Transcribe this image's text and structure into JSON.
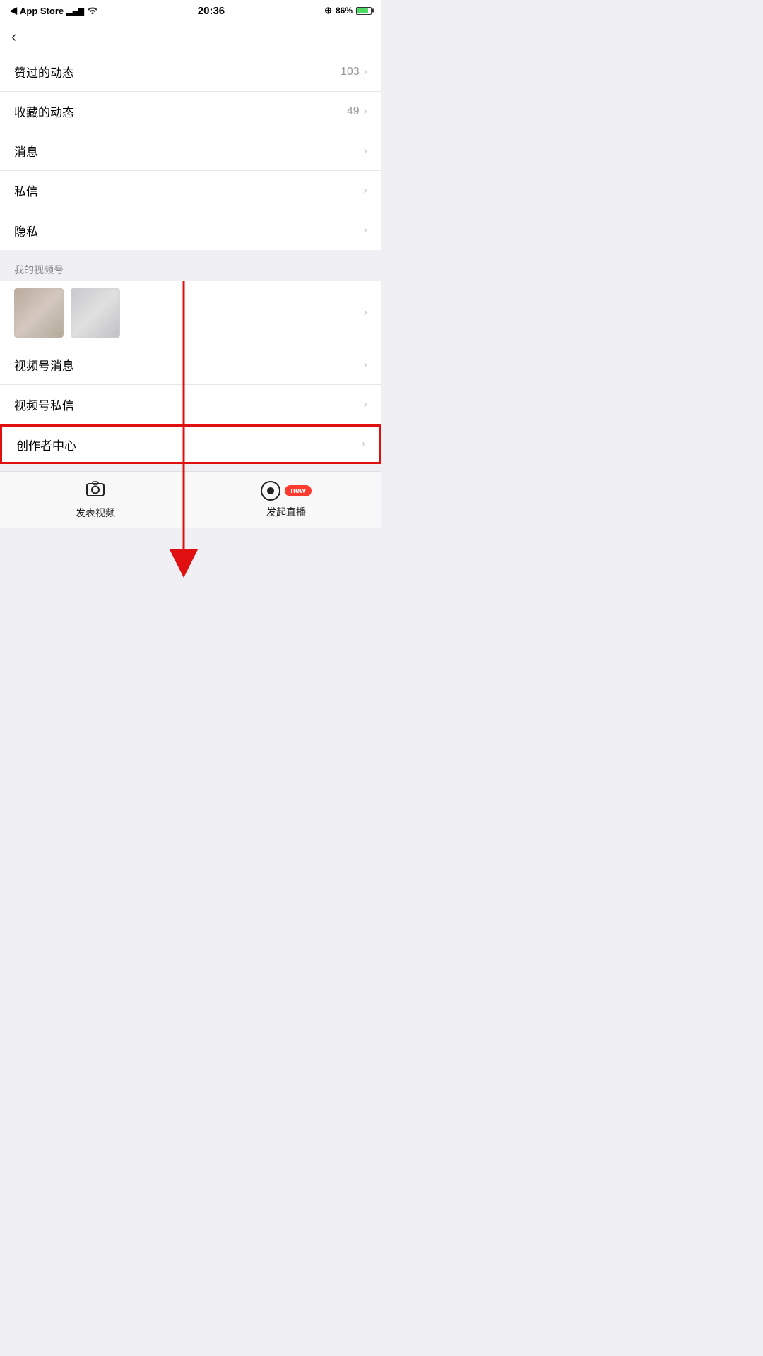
{
  "statusBar": {
    "carrier": "App Store",
    "time": "20:36",
    "battery": "86%",
    "batteryCharging": true
  },
  "nav": {
    "backLabel": "‹"
  },
  "menuItems": {
    "section1": [
      {
        "label": "赞过的动态",
        "value": "103",
        "showValue": true
      },
      {
        "label": "收藏的动态",
        "value": "49",
        "showValue": true
      },
      {
        "label": "消息",
        "value": "",
        "showValue": false
      },
      {
        "label": "私信",
        "value": "",
        "showValue": false
      },
      {
        "label": "隐私",
        "value": "",
        "showValue": false
      }
    ],
    "videoSectionHeader": "我的视频号",
    "section2": [
      {
        "label": "视频号消息",
        "value": "",
        "showValue": false
      },
      {
        "label": "视频号私信",
        "value": "",
        "showValue": false
      },
      {
        "label": "创作者中心",
        "value": "",
        "showValue": false,
        "highlighted": true
      }
    ]
  },
  "bottomBar": {
    "publishLabel": "发表视频",
    "liveLabel": "发起直播",
    "newBadge": "new"
  }
}
